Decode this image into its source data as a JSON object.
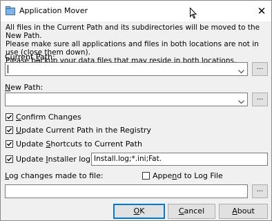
{
  "window": {
    "title": "Application Mover",
    "close_glyph": "✕"
  },
  "intro": [
    "All files in the Current Path and its subdirectories will be moved to the New Path.",
    "Please make sure all applications and files in both locations are not in use (close them down).",
    "Please backup your data files that may reside in both locations."
  ],
  "current_path": {
    "label_pre": "Current ",
    "label_key": "P",
    "label_post": "ath:",
    "value": "",
    "browse": "..."
  },
  "new_path": {
    "label_key": "N",
    "label_post": "ew Path:",
    "value": "",
    "browse": "..."
  },
  "options": {
    "confirm": {
      "key": "C",
      "rest": "onfirm Changes",
      "checked": true
    },
    "update_registry": {
      "key": "U",
      "rest": "pdate Current Path in the Registry",
      "checked": true
    },
    "update_shortcuts": {
      "pre": "Update ",
      "key": "S",
      "rest": "hortcuts to Current Path",
      "checked": true
    },
    "update_installer": {
      "pre": "Update ",
      "key": "I",
      "rest": "nstaller log files:",
      "checked": true,
      "value": "Install.log;*.ini;Fat."
    }
  },
  "log": {
    "label_key": "L",
    "label_post": "og changes made to file:",
    "append_pre": "Appe",
    "append_key": "n",
    "append_post": "d to Log File",
    "append_checked": false,
    "value": "",
    "browse": "..."
  },
  "buttons": {
    "ok_key": "O",
    "ok_rest": "K",
    "cancel_key": "C",
    "cancel_rest": "ancel",
    "about_key": "A",
    "about_rest": "bout"
  },
  "colors": {
    "accent": "#0078d7",
    "window_bg": "#f0f0f0"
  }
}
